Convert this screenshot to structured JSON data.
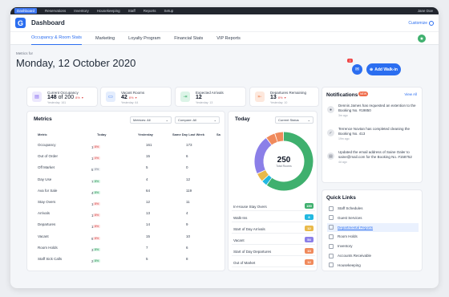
{
  "topnav": {
    "items": [
      {
        "label": "Dashboard"
      },
      {
        "label": "Reservations"
      },
      {
        "label": "Inventory"
      },
      {
        "label": "Housekeeping"
      },
      {
        "label": "Staff"
      },
      {
        "label": "Reports"
      },
      {
        "label": "Setup"
      }
    ],
    "user": "Jane Doe"
  },
  "header": {
    "title": "Dashboard",
    "customize": "Customize"
  },
  "tabs": [
    {
      "label": "Occupancy & Room Stats"
    },
    {
      "label": "Marketing"
    },
    {
      "label": "Loyalty Program"
    },
    {
      "label": "Financial Stats"
    },
    {
      "label": "VIP Reports"
    }
  ],
  "hero": {
    "metrics_for": "Metrics for",
    "date": "Monday, 12 October 2020",
    "walkin_label": "Add Walk-in",
    "mail_badge": "3"
  },
  "stats": [
    {
      "label": "Current Occupancy",
      "value": "148",
      "of": "of 200",
      "delta": "8%",
      "sub": "Yesterday: 161",
      "color": "#7c5cf0"
    },
    {
      "label": "Vacant Rooms",
      "value": "42",
      "of": "",
      "delta": "8%",
      "sub": "Yesterday: 64",
      "color": "#2b6ef0"
    },
    {
      "label": "Expected Arrivals",
      "value": "12",
      "of": "",
      "delta": "",
      "sub": "Yesterday: 13",
      "color": "#3fb06e"
    },
    {
      "label": "Departures Remaining",
      "value": "13",
      "of": "",
      "delta": "8%",
      "sub": "Yesterday: 10",
      "color": "#f08a5c"
    }
  ],
  "metrics": {
    "title": "Metrics",
    "select_metrics": "Metrices: All",
    "select_compare": "Compare: All",
    "columns": [
      "Metric",
      "Today",
      "Yesterday",
      "Same Day Last Week",
      "Sa"
    ],
    "rows": [
      {
        "metric": "Occupancy",
        "today": "148",
        "pill": "8%",
        "pill_type": "r",
        "yesterday": "161",
        "last_week": "173"
      },
      {
        "metric": "Out of Order",
        "today": "15",
        "pill": "0%",
        "pill_type": "r",
        "yesterday": "15",
        "last_week": "6"
      },
      {
        "metric": "Off Market",
        "today": "5",
        "pill": "0%",
        "pill_type": "gr",
        "yesterday": "5",
        "last_week": "0"
      },
      {
        "metric": "Day Use",
        "today": "7",
        "pill": "8%",
        "pill_type": "g",
        "yesterday": "4",
        "last_week": "12"
      },
      {
        "metric": "Ava for Sale",
        "today": "42",
        "pill": "8%",
        "pill_type": "g",
        "yesterday": "64",
        "last_week": "119"
      },
      {
        "metric": "Stay Overs",
        "today": "14",
        "pill": "8%",
        "pill_type": "r",
        "yesterday": "12",
        "last_week": "11"
      },
      {
        "metric": "Arrivals",
        "today": "14",
        "pill": "8%",
        "pill_type": "r",
        "yesterday": "13",
        "last_week": "4"
      },
      {
        "metric": "Departures",
        "today": "15",
        "pill": "8%",
        "pill_type": "r",
        "yesterday": "14",
        "last_week": "9"
      },
      {
        "metric": "Vacant",
        "today": "9",
        "pill": "8%",
        "pill_type": "r",
        "yesterday": "15",
        "last_week": "10"
      },
      {
        "metric": "Room Holds",
        "today": "3",
        "pill": "8%",
        "pill_type": "g",
        "yesterday": "7",
        "last_week": "6"
      },
      {
        "metric": "Staff Sick Calls",
        "today": "2",
        "pill": "8%",
        "pill_type": "g",
        "yesterday": "5",
        "last_week": "8"
      }
    ]
  },
  "today": {
    "title": "Today",
    "select_status": "Current Status",
    "total": "250",
    "total_label": "Total Rooms",
    "legend": [
      {
        "label": "In-House Stay Overs",
        "value": "150",
        "color": "#3fb06e"
      },
      {
        "label": "Walk-Ins",
        "value": "8",
        "color": "#22b8e0"
      },
      {
        "label": "Start of Day Arrivals",
        "value": "12",
        "color": "#e9b94a"
      },
      {
        "label": "Vacant",
        "value": "54",
        "color": "#8b7fe8"
      },
      {
        "label": "Start of Day Departures",
        "value": "13",
        "color": "#f08a5c"
      },
      {
        "label": "Out of Market",
        "value": "12",
        "color": "#f08a5c"
      }
    ]
  },
  "notifications": {
    "title": "Notifications",
    "badge": "NEW",
    "view_all": "View All",
    "items": [
      {
        "text": "Dennis James has requested an extention to the Booking No. #19850",
        "time": "3m ago"
      },
      {
        "text": "Terrence Novtan has completed cleaning the Booking No. 413",
        "time": "19m ago"
      },
      {
        "text": "Updated the email address of Saine Oaler to saine@mail.com for the Booking No. #158752",
        "time": "4d ago"
      }
    ]
  },
  "quicklinks": {
    "title": "Quick Links",
    "items": [
      {
        "label": "Staff Schedules"
      },
      {
        "label": "Guest Services"
      },
      {
        "label": "Departmental Reports"
      },
      {
        "label": "Room Holds"
      },
      {
        "label": "Inventory"
      },
      {
        "label": "Accounts Receivable"
      },
      {
        "label": "Housekeeping"
      }
    ]
  }
}
